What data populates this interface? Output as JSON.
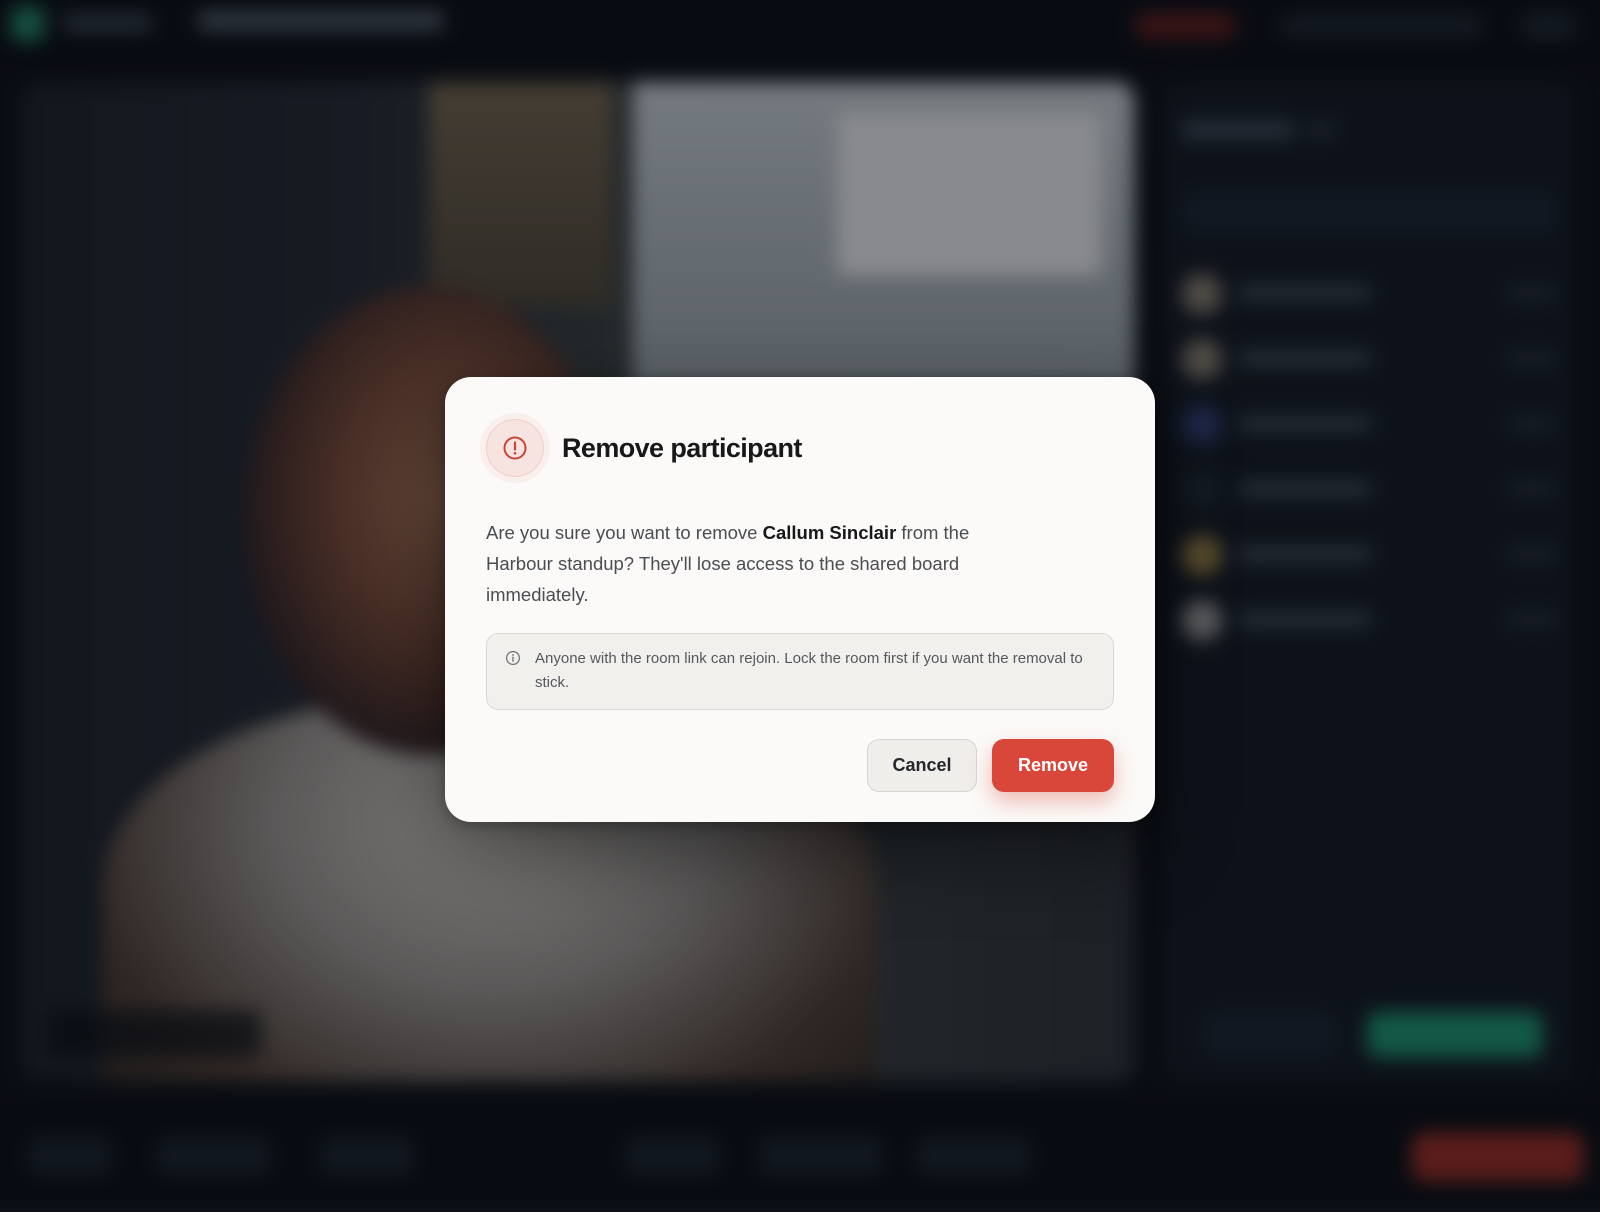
{
  "dialog": {
    "title": "Remove participant",
    "message_prefix": "Are you sure you want to remove ",
    "participant_name": "Callum Sinclair",
    "message_suffix": " from the Harbour standup? They'll lose access to the shared board immediately.",
    "note": "Anyone with the room link can rejoin. Lock the room first if you want the removal to stick.",
    "cancel_label": "Cancel",
    "confirm_label": "Remove",
    "icons": {
      "header": "alert-circle-icon",
      "note": "info-icon"
    }
  },
  "colors": {
    "accent_danger": "#d9463a",
    "dialog_background": "#fbfaf8",
    "app_background": "#0d1117"
  }
}
